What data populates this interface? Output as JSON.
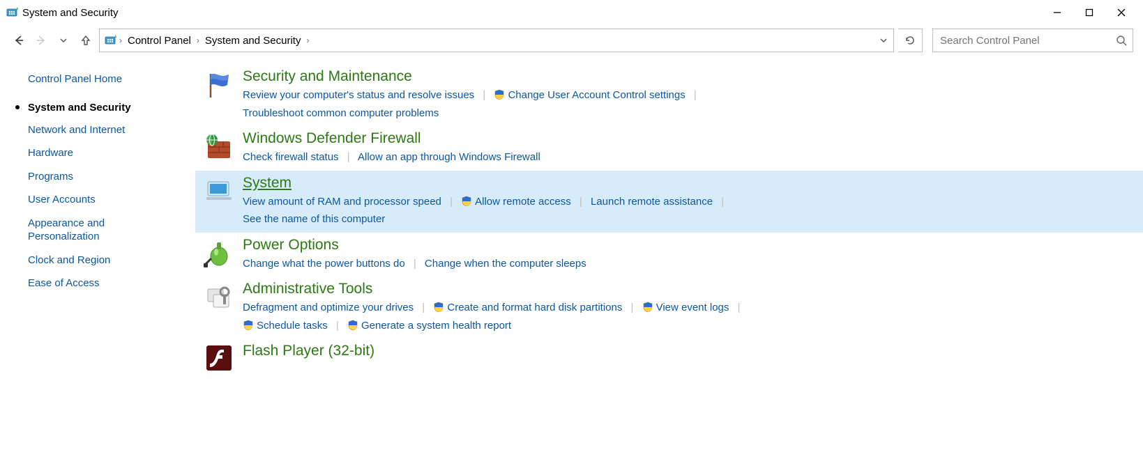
{
  "window": {
    "title": "System and Security"
  },
  "breadcrumb": {
    "root": "Control Panel",
    "current": "System and Security"
  },
  "search": {
    "placeholder": "Search Control Panel"
  },
  "sidebar": {
    "home": "Control Panel Home",
    "items": [
      "System and Security",
      "Network and Internet",
      "Hardware",
      "Programs",
      "User Accounts",
      "Appearance and Personalization",
      "Clock and Region",
      "Ease of Access"
    ]
  },
  "categories": {
    "security": {
      "title": "Security and Maintenance",
      "t1": "Review your computer's status and resolve issues",
      "t2": "Change User Account Control settings",
      "t3": "Troubleshoot common computer problems"
    },
    "firewall": {
      "title": "Windows Defender Firewall",
      "t1": "Check firewall status",
      "t2": "Allow an app through Windows Firewall"
    },
    "system": {
      "title": "System",
      "t1": "View amount of RAM and processor speed",
      "t2": "Allow remote access",
      "t3": "Launch remote assistance",
      "t4": "See the name of this computer"
    },
    "power": {
      "title": "Power Options",
      "t1": "Change what the power buttons do",
      "t2": "Change when the computer sleeps"
    },
    "admin": {
      "title": "Administrative Tools",
      "t1": "Defragment and optimize your drives",
      "t2": "Create and format hard disk partitions",
      "t3": "View event logs",
      "t4": "Schedule tasks",
      "t5": "Generate a system health report"
    },
    "flash": {
      "title": "Flash Player (32-bit)"
    }
  }
}
